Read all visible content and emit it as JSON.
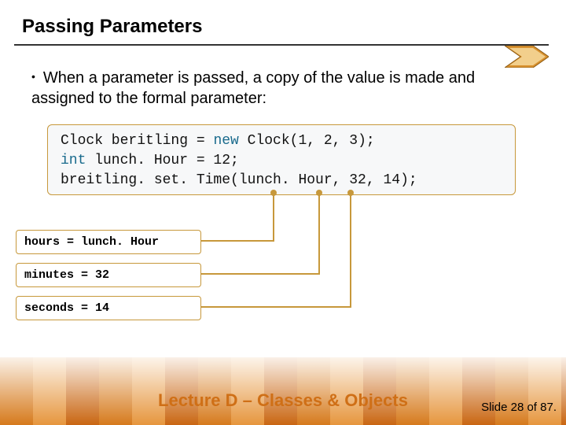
{
  "title": "Passing Parameters",
  "bullet": "When a parameter is passed, a copy of the value is made and assigned to the formal parameter:",
  "code": {
    "line1a": "Clock beritling = ",
    "line1_kw": "new",
    "line1b": " Clock(1, 2, 3);",
    "line2_kw": "int",
    "line2b": " lunch. Hour = 12;",
    "line3": "breitling. set. Time(lunch. Hour, 32, 14);"
  },
  "labels": {
    "hours": "hours = lunch. Hour",
    "minutes": "minutes = 32",
    "seconds": "seconds = 14"
  },
  "footer": {
    "lecture": "Lecture D – Classes & Objects",
    "slide": "Slide 28 of 87."
  }
}
